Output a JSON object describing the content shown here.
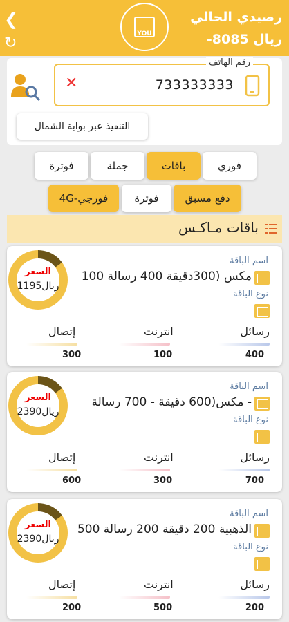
{
  "header": {
    "title": "رصيدي الحالي",
    "balance": "-8085 ريال",
    "logo_text": "YOU"
  },
  "phone": {
    "label": "رقم الهاتف",
    "value": "733333333",
    "north_gateway_label": "التنفيذ عبر بوابة الشمال"
  },
  "tabs_row1": [
    {
      "label": "فوري",
      "active": false
    },
    {
      "label": "باقات",
      "active": true
    },
    {
      "label": "جملة",
      "active": false
    },
    {
      "label": "فوترة",
      "active": false
    }
  ],
  "tabs_row2": [
    {
      "label": "دفع مسبق",
      "active": true
    },
    {
      "label": "فوترة",
      "active": false
    },
    {
      "label": "4G-فورجي",
      "active": true
    }
  ],
  "section": {
    "title": "باقات مـاكـس"
  },
  "labels": {
    "package_name": "اسم الباقة",
    "package_type": "نوع الباقة",
    "price": "السعر",
    "sms": "رسائل",
    "internet": "انترنت",
    "calls": "إتصال"
  },
  "colors": {
    "accent": "#f6bf38",
    "sms_bar": "#b9c8ea",
    "internet_bar": "#f5c0c8",
    "calls_bar": "#f6dfa2"
  },
  "packages": [
    {
      "name": "مكس (300دقيقة 400 رسالة 100",
      "price": "1195ريال",
      "sms": "400",
      "internet": "100",
      "calls": "300",
      "ring_fraction": 0.15
    },
    {
      "name": "مكس(600 دقيقة - 700 رسالة -",
      "price": "2390ريال",
      "sms": "700",
      "internet": "300",
      "calls": "600",
      "ring_fraction": 0.15
    },
    {
      "name": "الذهبية 200 دقيقة 200 رسالة 500",
      "price": "2390ريال",
      "sms": "200",
      "internet": "500",
      "calls": "200",
      "ring_fraction": 0.15
    }
  ]
}
